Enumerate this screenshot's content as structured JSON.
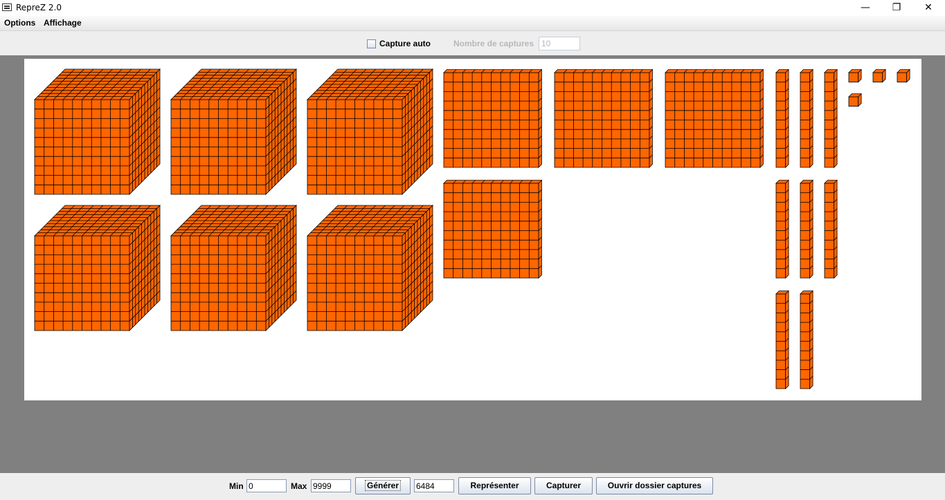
{
  "window": {
    "title": "RepreZ 2.0",
    "controls": {
      "minimize": "—",
      "maximize": "❐",
      "close": "✕"
    }
  },
  "menu": [
    "Options",
    "Affichage"
  ],
  "toolbar": {
    "capture_auto_label": "Capture auto",
    "capture_auto_checked": false,
    "nombre_label": "Nombre de captures",
    "nombre_value": "10"
  },
  "representation": {
    "number": 6484,
    "blocks": {
      "thousands": 6,
      "hundreds": 4,
      "tens": 8,
      "units": 4
    },
    "color": "#ff6600",
    "edge_color": "#000000"
  },
  "bottom": {
    "min_label": "Min",
    "min_value": "0",
    "max_label": "Max",
    "max_value": "9999",
    "generate_label": "Générer",
    "value": "6484",
    "represent_label": "Représenter",
    "capture_label": "Capturer",
    "open_folder_label": "Ouvrir dossier captures"
  }
}
